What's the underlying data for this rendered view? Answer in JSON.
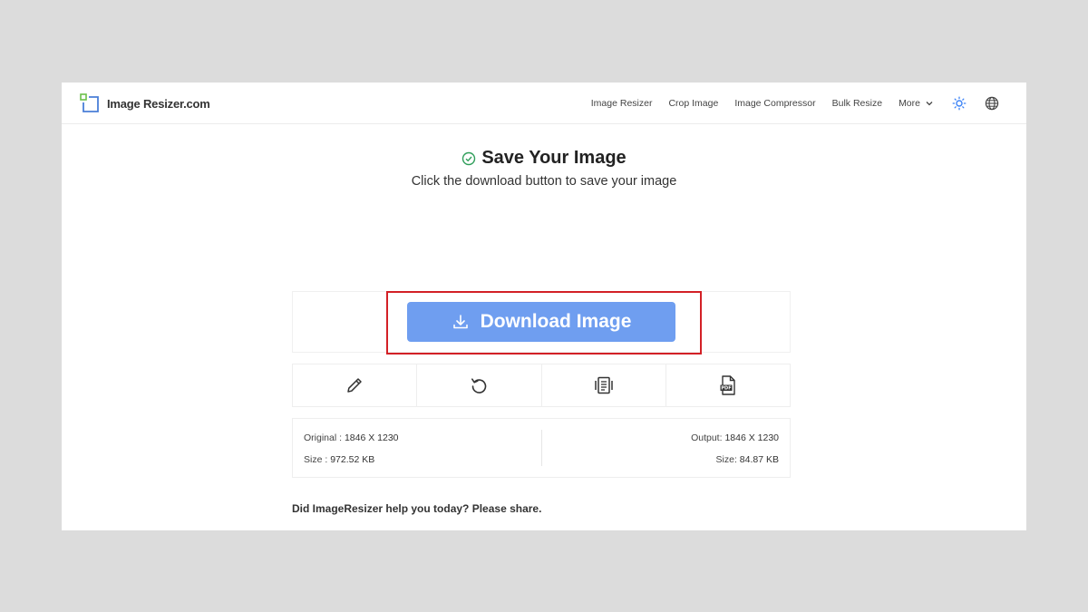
{
  "header": {
    "logo_text": "Image Resizer.com",
    "nav": {
      "image_resizer": "Image Resizer",
      "crop_image": "Crop Image",
      "image_compressor": "Image Compressor",
      "bulk_resize": "Bulk Resize",
      "more": "More"
    },
    "icons": [
      "logo-icon",
      "chevron-down-icon",
      "sun-icon",
      "globe-icon"
    ]
  },
  "main": {
    "title": "Save Your Image",
    "subtitle": "Click the download button to save your image",
    "download_label": "Download Image",
    "tools": [
      "pencil-icon",
      "undo-icon",
      "compress-icon",
      "pdf-icon"
    ],
    "info": {
      "original_label": "Original : ",
      "original_value": "1846 X 1230",
      "original_size_label": "Size : ",
      "original_size_value": "972.52 KB",
      "output_label": "Output: ",
      "output_value": "1846 X 1230",
      "output_size_label": "Size: ",
      "output_size_value": "84.87 KB"
    },
    "share_text": "Did ImageResizer help you today? Please share."
  },
  "colors": {
    "accent_button": "#6f9ef0",
    "highlight_border": "#d32026",
    "check_green": "#2f9e5a",
    "logo_green": "#6cc04a",
    "logo_blue": "#4a7fd8"
  }
}
